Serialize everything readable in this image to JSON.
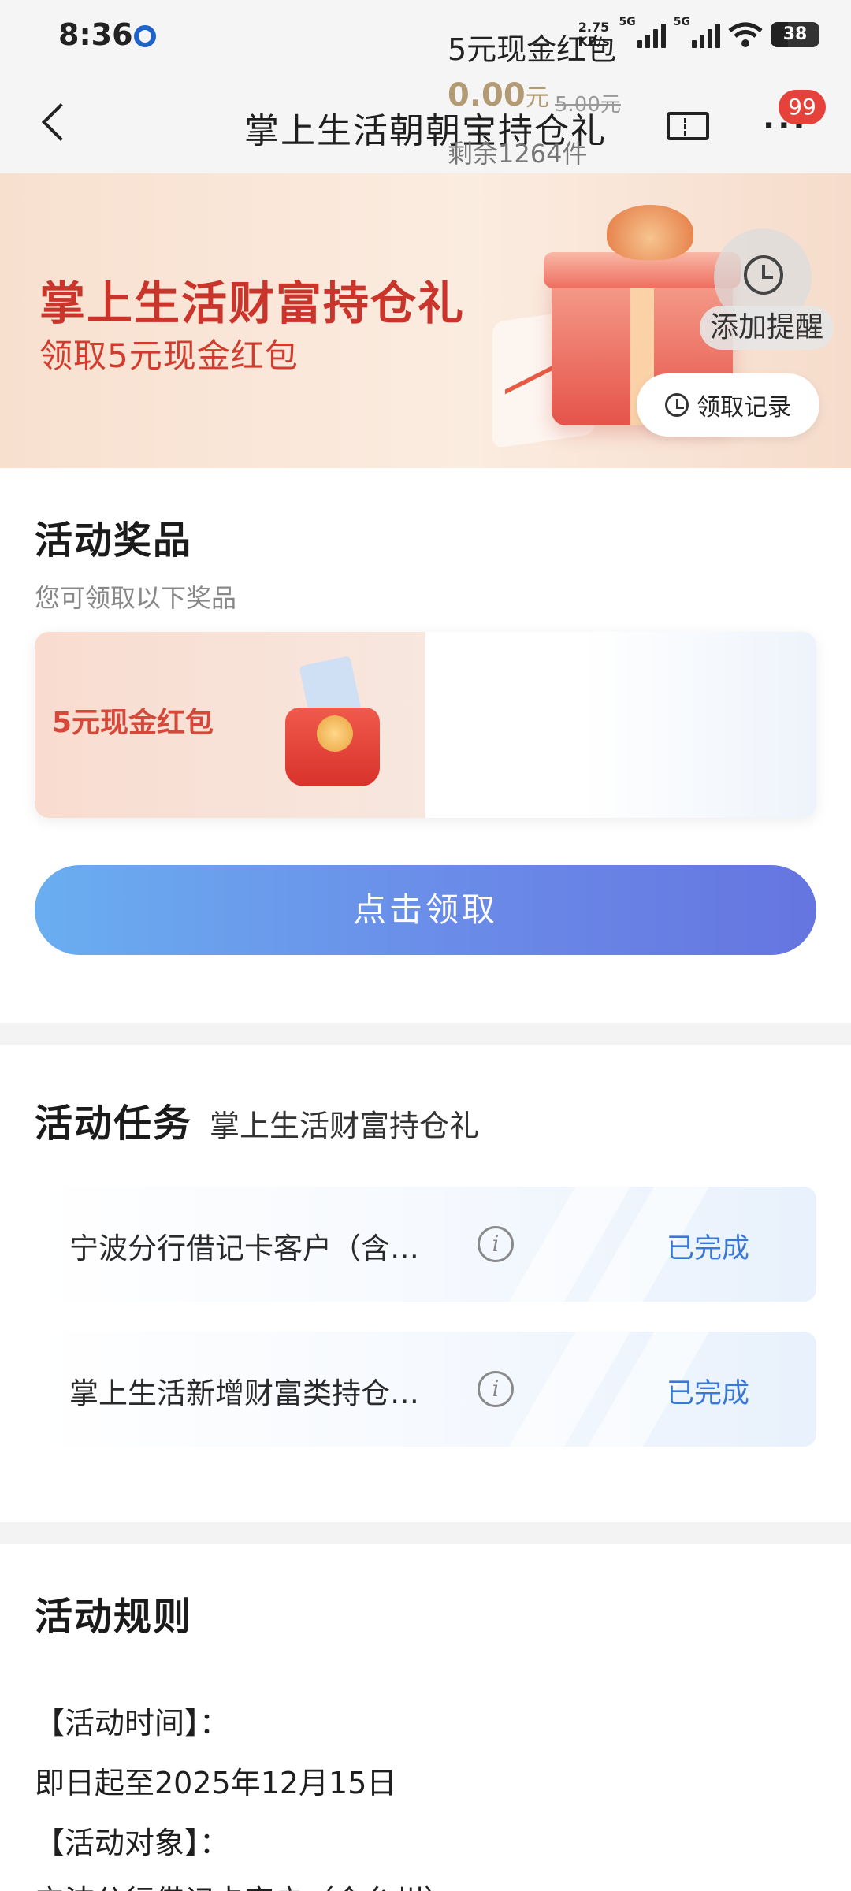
{
  "status_bar": {
    "time": "8:36",
    "net_speed_value": "2.75",
    "net_speed_unit": "KB/s",
    "network_1": "5G",
    "network_2": "5G",
    "battery": "38"
  },
  "nav": {
    "title": "掌上生活朝朝宝持仓礼",
    "badge_count": "99"
  },
  "banner": {
    "title": "掌上生活财富持仓礼",
    "subtitle": "领取5元现金红包",
    "remind_label": "添加提醒",
    "records_label": "领取记录"
  },
  "prizes": {
    "title": "活动奖品",
    "subtitle": "您可领取以下奖品",
    "item": {
      "image_label": "5元现金红包",
      "name": "5元现金红包",
      "price": "0.00",
      "price_unit": "元",
      "original_price": "5.00元",
      "stock": "剩余1264件"
    },
    "claim_button": "点击领取"
  },
  "tasks": {
    "title": "活动任务",
    "subtitle": "掌上生活财富持仓礼",
    "items": [
      {
        "label": "宁波分行借记卡客户（含…",
        "status": "已完成"
      },
      {
        "label": "掌上生活新增财富类持仓…",
        "status": "已完成"
      }
    ]
  },
  "rules": {
    "title": "活动规则",
    "lines": [
      "【活动时间】：",
      "即日起至2025年12月15日",
      "【活动对象】：",
      "宁波分行借记卡客户（含台州）"
    ]
  },
  "colors": {
    "accent_red": "#c9342b",
    "button_blue": "#6a8be8",
    "status_blue": "#3a78d6",
    "badge_red": "#e5423b"
  }
}
